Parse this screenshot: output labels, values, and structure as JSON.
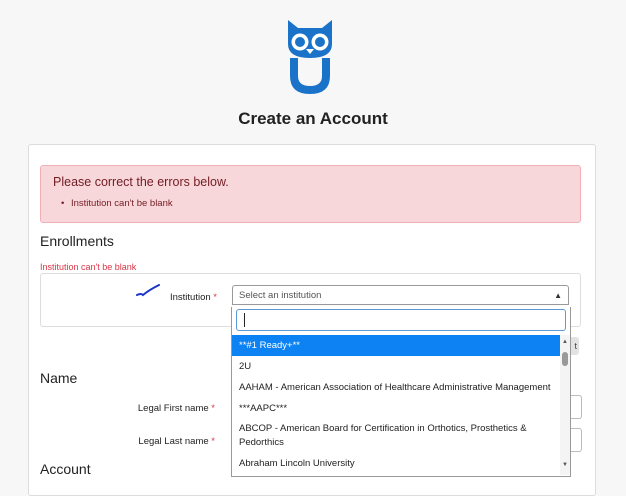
{
  "header": {
    "title": "Create an Account"
  },
  "alert": {
    "heading": "Please correct the errors below.",
    "errors": [
      "Institution can't be blank"
    ]
  },
  "enrollments": {
    "section_title": "Enrollments",
    "field_error": "Institution can't be blank",
    "institution_label": "Institution",
    "required_mark": "*",
    "select_placeholder": "Select an institution",
    "next_stub": "t"
  },
  "dropdown": {
    "search_value": "",
    "options": [
      "**#1 Ready+**",
      "2U",
      "AAHAM - American Association of Healthcare Administrative Management",
      "***AAPC***",
      "ABCOP - American Board for Certification in Orthotics, Prosthetics & Pedorthics",
      "Abraham Lincoln University"
    ],
    "selected_index": 0
  },
  "name_section": {
    "section_title": "Name",
    "first_label": "Legal First name",
    "last_label": "Legal Last name",
    "required_mark": "*"
  },
  "account_section": {
    "section_title": "Account"
  },
  "colors": {
    "brand": "#1a73c8",
    "error": "#dc3545",
    "alert_bg": "#f8d7da",
    "alert_text": "#721c24",
    "selected_bg": "#0d82f2"
  }
}
